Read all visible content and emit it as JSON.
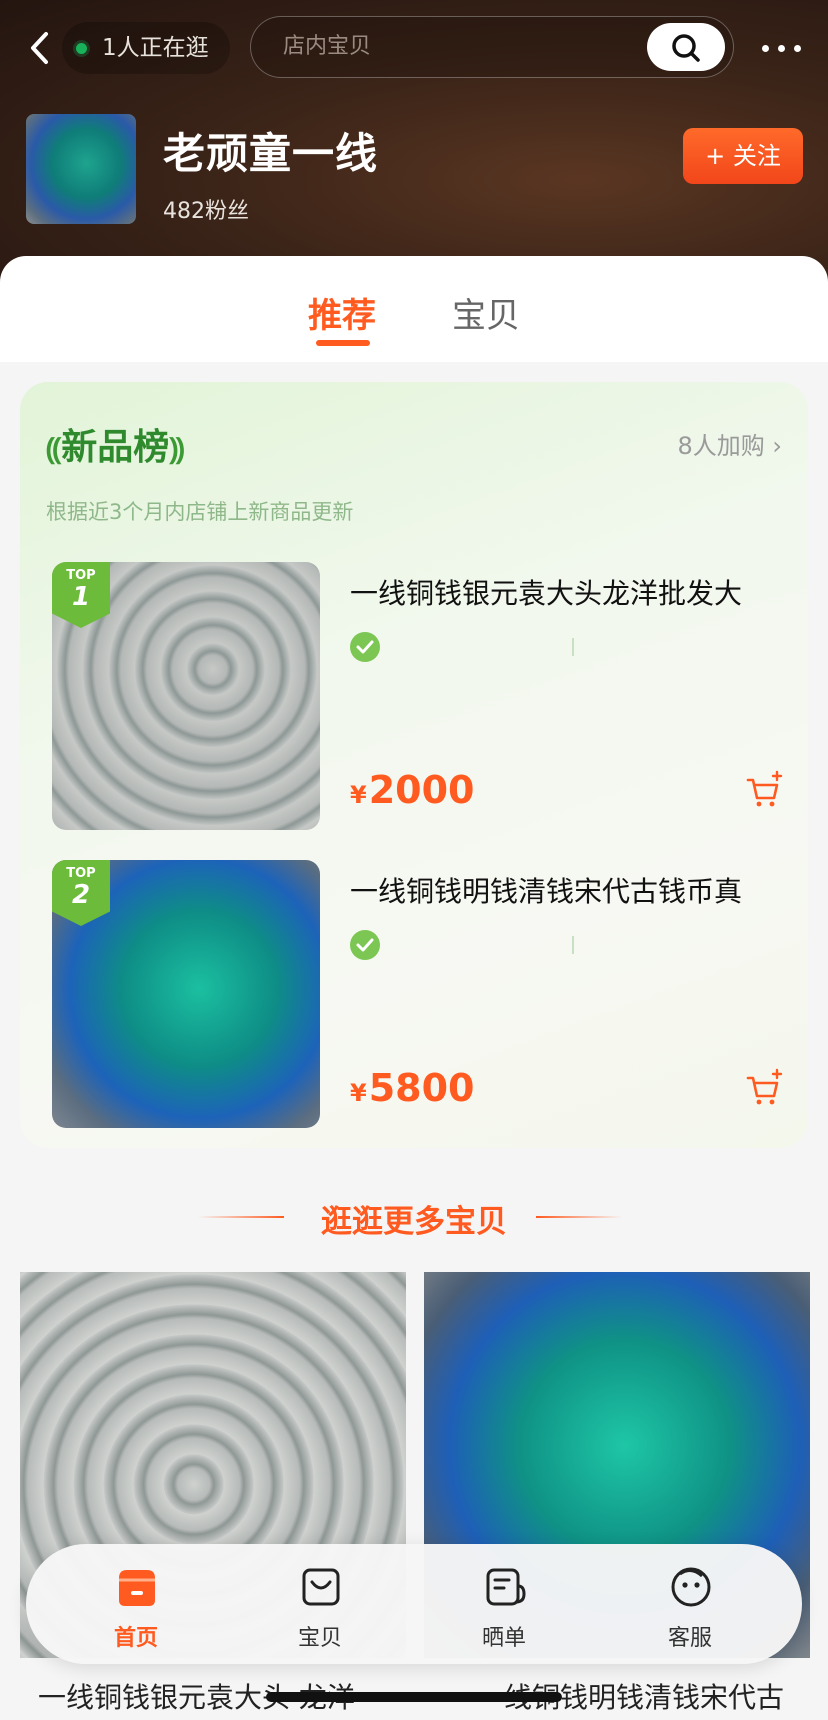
{
  "header": {
    "visitors_text": "1人正在逛",
    "search_placeholder": "店内宝贝",
    "shop_name": "老顽童一线",
    "fans": "482粉丝",
    "follow_label": "+ 关注"
  },
  "tabs": [
    {
      "label": "推荐",
      "active": true
    },
    {
      "label": "宝贝",
      "active": false
    }
  ],
  "new_arrivals": {
    "title": "新品榜",
    "cart_count": "8人加购",
    "subtitle": "根据近3个月内店铺上新商品更新",
    "items": [
      {
        "badge_top": "TOP",
        "rank": "1",
        "name": "一线铜钱银元袁大头龙洋批发大",
        "currency": "¥",
        "price": "2000"
      },
      {
        "badge_top": "TOP",
        "rank": "2",
        "name": "一线铜钱明钱清钱宋代古钱币真",
        "currency": "¥",
        "price": "5800"
      }
    ]
  },
  "more": {
    "title": "逛逛更多宝贝",
    "items": [
      {
        "name": "一线铜钱银元袁大头 龙洋"
      },
      {
        "name": "一线铜钱明钱清钱宋代古"
      }
    ]
  },
  "bottom_nav": [
    {
      "label": "首页",
      "icon": "home-icon",
      "active": true
    },
    {
      "label": "宝贝",
      "icon": "bag-icon",
      "active": false
    },
    {
      "label": "晒单",
      "icon": "review-icon",
      "active": false
    },
    {
      "label": "客服",
      "icon": "service-icon",
      "active": false
    }
  ],
  "colors": {
    "accent": "#ff5a1f",
    "green": "#2f8a2e",
    "header_bg": "#3b2418"
  }
}
